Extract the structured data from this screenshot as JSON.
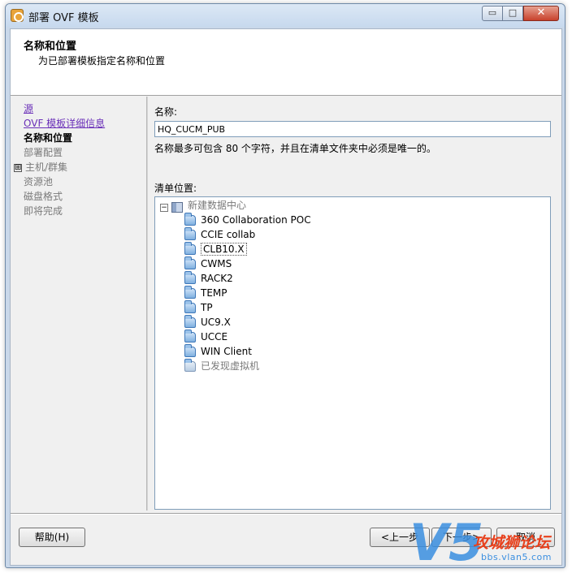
{
  "window": {
    "title": "部署 OVF 模板",
    "minimize": "▭",
    "maximize": "□",
    "close": "✕"
  },
  "header": {
    "title": "名称和位置",
    "subtitle": "为已部署模板指定名称和位置"
  },
  "steps": [
    {
      "label": "源",
      "state": "link"
    },
    {
      "label": "OVF 模板详细信息",
      "state": "link"
    },
    {
      "label": "名称和位置",
      "state": "current"
    },
    {
      "label": "部署配置",
      "state": "pending"
    },
    {
      "label": "主机/群集",
      "state": "pending",
      "expander": "⊞"
    },
    {
      "label": "资源池",
      "state": "pending"
    },
    {
      "label": "磁盘格式",
      "state": "pending"
    },
    {
      "label": "即将完成",
      "state": "pending"
    }
  ],
  "form": {
    "name_label": "名称:",
    "name_value": "HQ_CUCM_PUB",
    "name_hint": "名称最多可包含 80 个字符，并且在清单文件夹中必须是唯一的。",
    "inventory_label": "清单位置:"
  },
  "tree": {
    "root_toggle": "−",
    "root_label": "新建数据中心",
    "items": [
      {
        "label": "360 Collaboration POC"
      },
      {
        "label": "CCIE collab"
      },
      {
        "label": "CLB10.X",
        "selected": true
      },
      {
        "label": "CWMS"
      },
      {
        "label": "RACK2"
      },
      {
        "label": "TEMP"
      },
      {
        "label": "TP"
      },
      {
        "label": "UC9.X"
      },
      {
        "label": "UCCE"
      },
      {
        "label": "WIN Client"
      },
      {
        "label": "已发现虚拟机",
        "muted": true
      }
    ]
  },
  "buttons": {
    "help": "帮助(H)",
    "back": "<上一步",
    "next": "下一步>",
    "cancel": "取消"
  },
  "watermark": {
    "logo": "V5",
    "name": "攻城狮论坛",
    "url": "bbs.vlan5.com"
  }
}
